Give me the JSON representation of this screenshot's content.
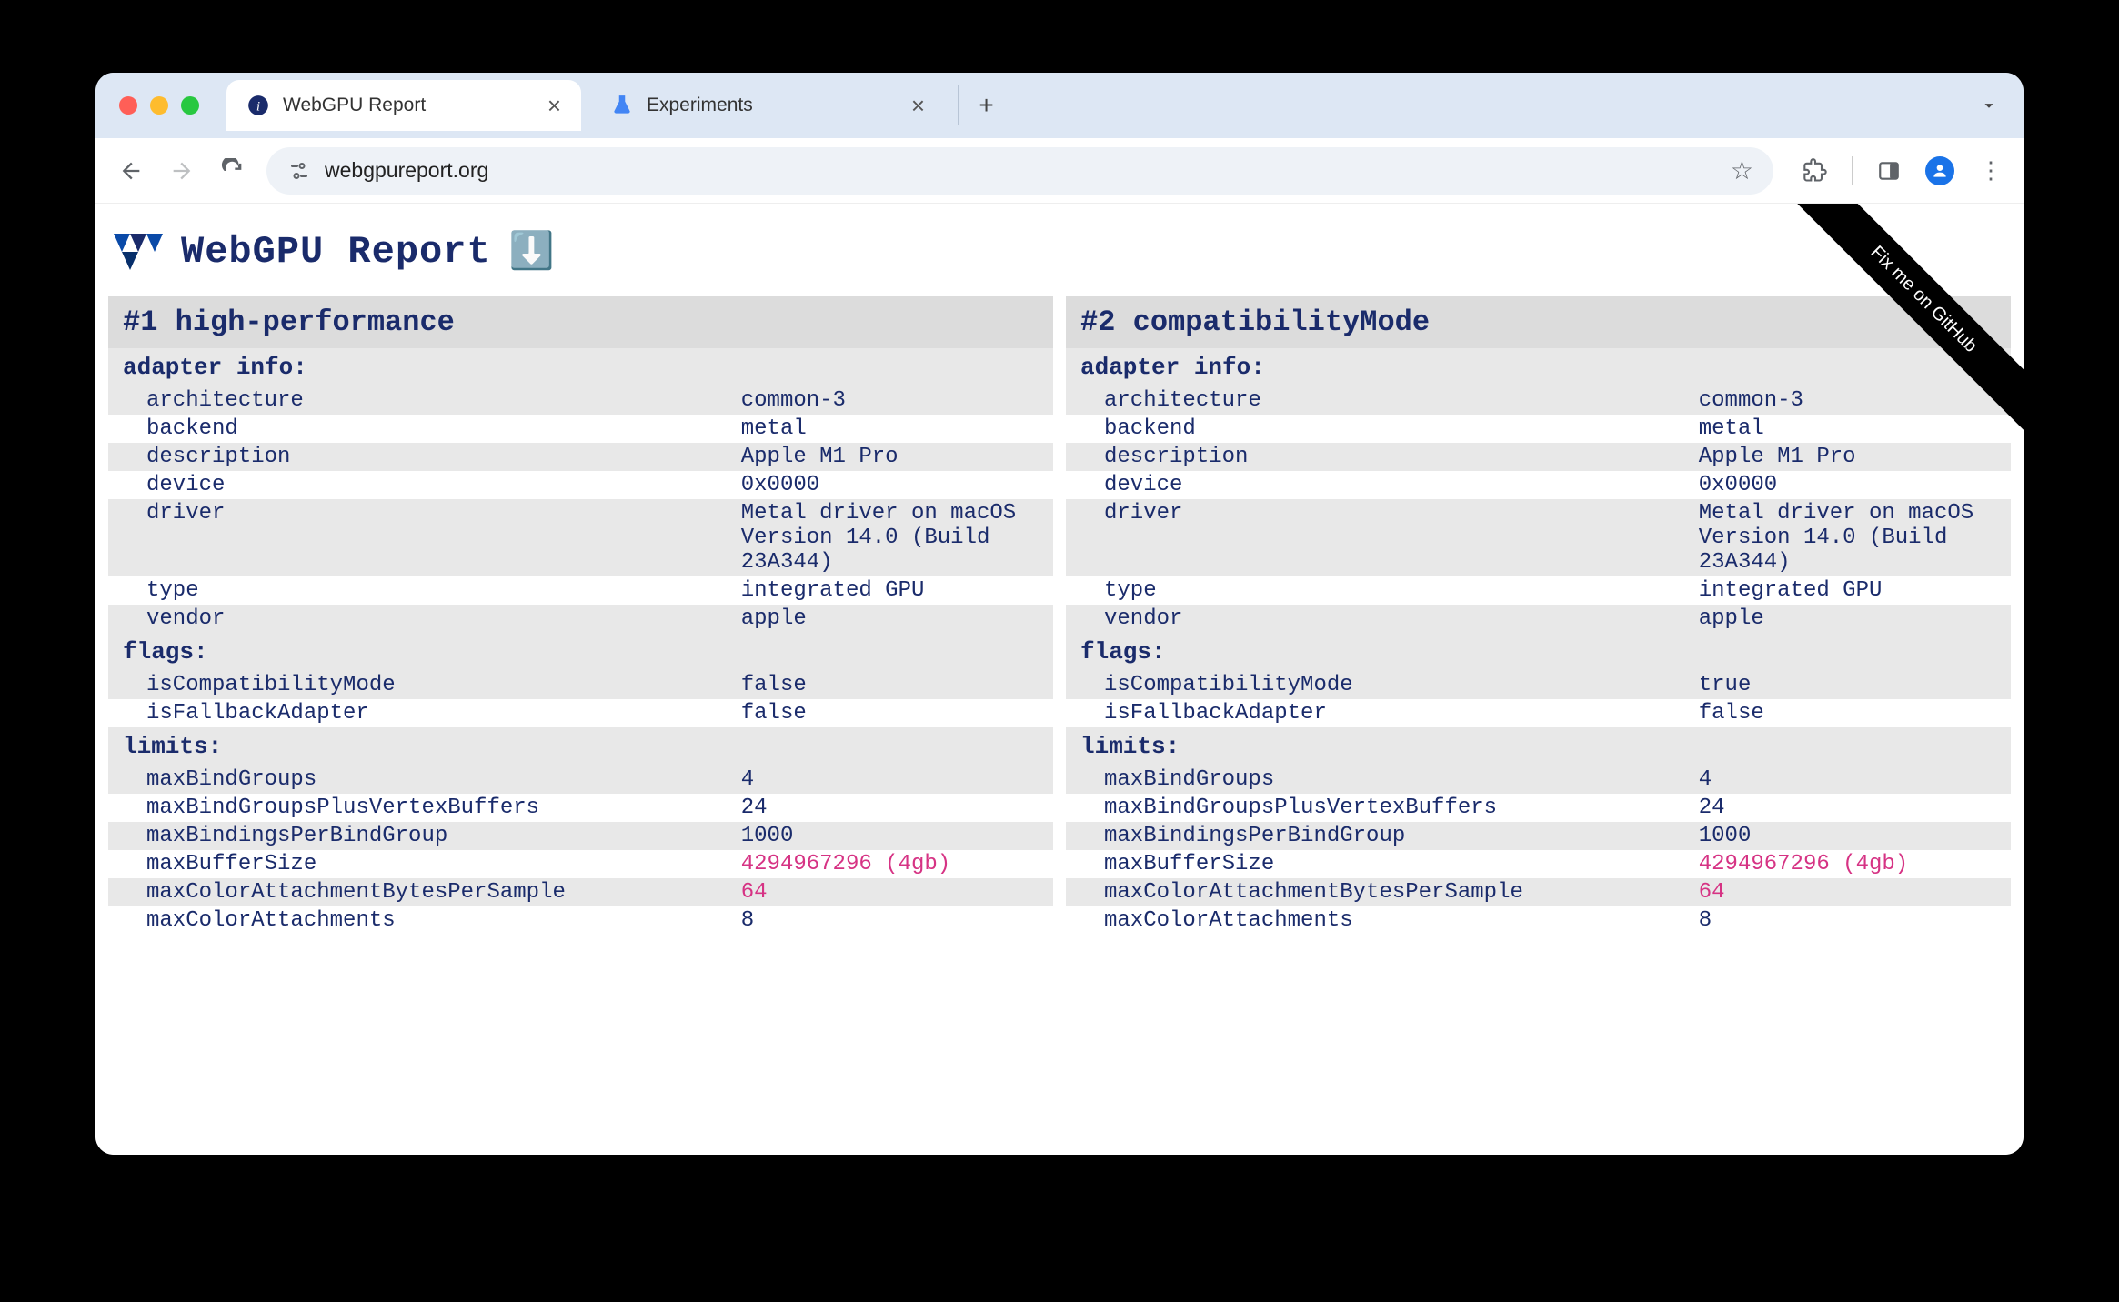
{
  "browser": {
    "tabs": [
      {
        "title": "WebGPU Report",
        "active": true
      },
      {
        "title": "Experiments",
        "active": false
      }
    ],
    "url": "webgpureport.org"
  },
  "page": {
    "title": "WebGPU Report",
    "ribbon": "Fix me on GitHub"
  },
  "adapters": [
    {
      "heading": "#1 high-performance",
      "info_label": "adapter info:",
      "info": [
        {
          "k": "architecture",
          "v": "common-3"
        },
        {
          "k": "backend",
          "v": "metal"
        },
        {
          "k": "description",
          "v": "Apple M1 Pro"
        },
        {
          "k": "device",
          "v": "0x0000"
        },
        {
          "k": "driver",
          "v": "Metal driver on macOS Version 14.0 (Build 23A344)"
        },
        {
          "k": "type",
          "v": "integrated GPU"
        },
        {
          "k": "vendor",
          "v": "apple"
        }
      ],
      "flags_label": "flags:",
      "flags": [
        {
          "k": "isCompatibilityMode",
          "v": "false"
        },
        {
          "k": "isFallbackAdapter",
          "v": "false"
        }
      ],
      "limits_label": "limits:",
      "limits": [
        {
          "k": "maxBindGroups",
          "v": "4"
        },
        {
          "k": "maxBindGroupsPlusVertexBuffers",
          "v": "24"
        },
        {
          "k": "maxBindingsPerBindGroup",
          "v": "1000"
        },
        {
          "k": "maxBufferSize",
          "v": "4294967296 (4gb)",
          "nondefault": true
        },
        {
          "k": "maxColorAttachmentBytesPerSample",
          "v": "64",
          "nondefault": true
        },
        {
          "k": "maxColorAttachments",
          "v": "8"
        }
      ]
    },
    {
      "heading": "#2 compatibilityMode",
      "info_label": "adapter info:",
      "info": [
        {
          "k": "architecture",
          "v": "common-3"
        },
        {
          "k": "backend",
          "v": "metal"
        },
        {
          "k": "description",
          "v": "Apple M1 Pro"
        },
        {
          "k": "device",
          "v": "0x0000"
        },
        {
          "k": "driver",
          "v": "Metal driver on macOS Version 14.0 (Build 23A344)"
        },
        {
          "k": "type",
          "v": "integrated GPU"
        },
        {
          "k": "vendor",
          "v": "apple"
        }
      ],
      "flags_label": "flags:",
      "flags": [
        {
          "k": "isCompatibilityMode",
          "v": "true"
        },
        {
          "k": "isFallbackAdapter",
          "v": "false"
        }
      ],
      "limits_label": "limits:",
      "limits": [
        {
          "k": "maxBindGroups",
          "v": "4"
        },
        {
          "k": "maxBindGroupsPlusVertexBuffers",
          "v": "24"
        },
        {
          "k": "maxBindingsPerBindGroup",
          "v": "1000"
        },
        {
          "k": "maxBufferSize",
          "v": "4294967296 (4gb)",
          "nondefault": true
        },
        {
          "k": "maxColorAttachmentBytesPerSample",
          "v": "64",
          "nondefault": true
        },
        {
          "k": "maxColorAttachments",
          "v": "8"
        }
      ]
    }
  ]
}
